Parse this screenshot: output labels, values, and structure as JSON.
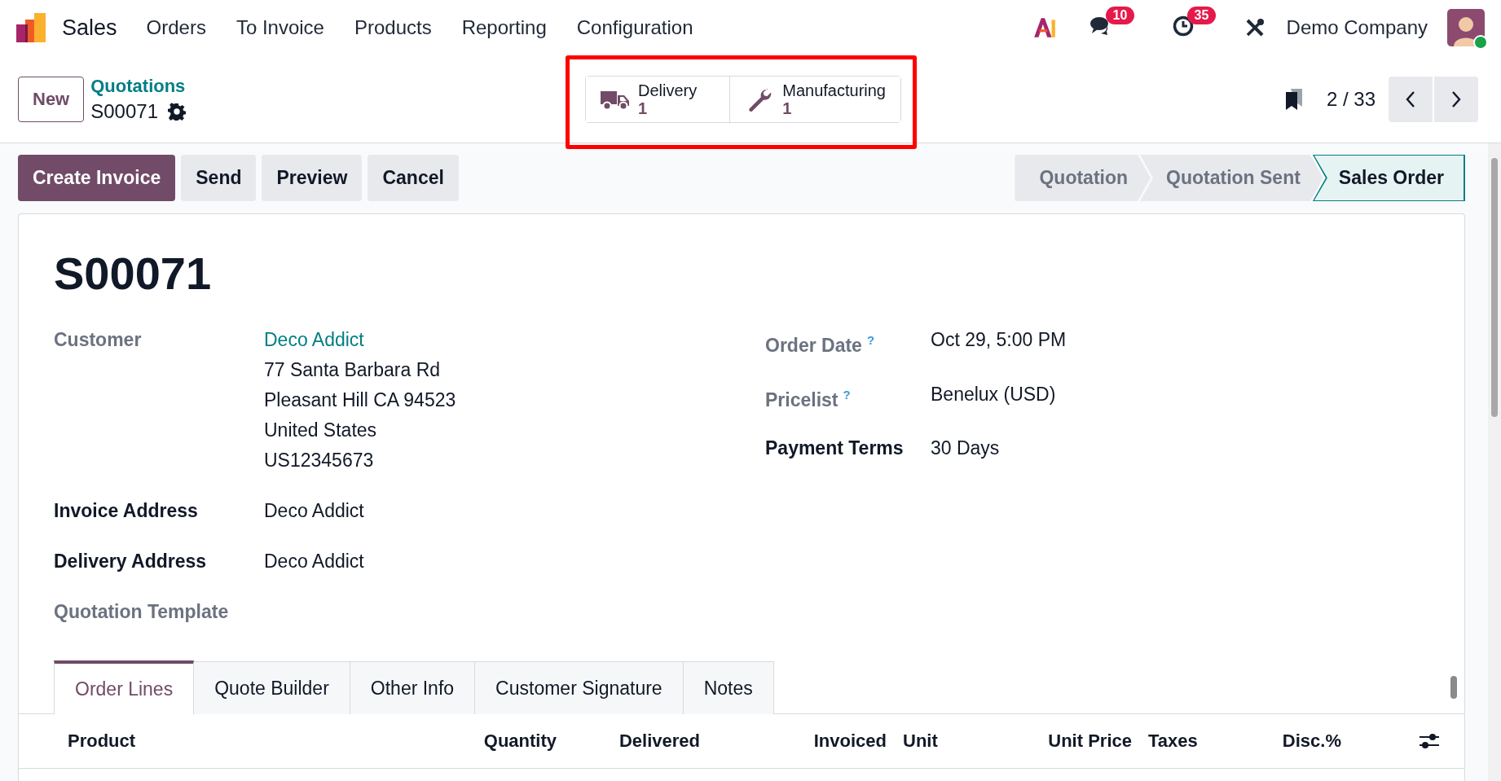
{
  "navbar": {
    "app_name": "Sales",
    "menu": [
      "Orders",
      "To Invoice",
      "Products",
      "Reporting",
      "Configuration"
    ],
    "message_count": "10",
    "activity_count": "35",
    "company": "Demo Company"
  },
  "control_panel": {
    "new_button": "New",
    "breadcrumb": "Quotations",
    "record": "S00071",
    "pager": "2 / 33",
    "smart_buttons": [
      {
        "kind": "truck",
        "label": "Delivery",
        "count": "1"
      },
      {
        "kind": "wrench",
        "label": "Manufacturing",
        "count": "1"
      }
    ]
  },
  "actions": [
    {
      "label": "Create Invoice",
      "primary": true
    },
    {
      "label": "Send",
      "primary": false
    },
    {
      "label": "Preview",
      "primary": false
    },
    {
      "label": "Cancel",
      "primary": false
    }
  ],
  "status_bar": [
    {
      "label": "Quotation",
      "selected": false
    },
    {
      "label": "Quotation Sent",
      "selected": false
    },
    {
      "label": "Sales Order",
      "selected": true
    }
  ],
  "form": {
    "title": "S00071",
    "left_fields": [
      {
        "label": "Customer",
        "required": false,
        "link": "Deco Addict",
        "values": [
          "77 Santa Barbara Rd",
          "Pleasant Hill CA 94523",
          "United States",
          "US12345673"
        ]
      },
      {
        "label": "Invoice Address",
        "required": true,
        "values": [
          "Deco Addict"
        ]
      },
      {
        "label": "Delivery Address",
        "required": true,
        "values": [
          "Deco Addict"
        ]
      },
      {
        "label": "Quotation Template",
        "required": false
      }
    ],
    "right_fields": [
      {
        "label": "Order Date",
        "required": false,
        "help_mark": "?",
        "values": [
          "Oct 29, 5:00 PM"
        ]
      },
      {
        "label": "Pricelist",
        "required": false,
        "help_mark": "?",
        "values": [
          "Benelux (USD)"
        ]
      },
      {
        "label": "Payment Terms",
        "required": true,
        "values": [
          "30 Days"
        ]
      }
    ]
  },
  "tabs": [
    {
      "label": "Order Lines",
      "selected": true
    },
    {
      "label": "Quote Builder",
      "selected": false
    },
    {
      "label": "Other Info",
      "selected": false
    },
    {
      "label": "Customer Signature",
      "selected": false
    },
    {
      "label": "Notes",
      "selected": false
    }
  ],
  "table": {
    "columns": [
      {
        "label": "Product",
        "kind": "text"
      },
      {
        "label": "Quantity",
        "kind": "number"
      },
      {
        "label": "Delivered",
        "kind": "number"
      },
      {
        "label": "Invoiced",
        "kind": "number"
      },
      {
        "label": "Unit",
        "kind": "text"
      },
      {
        "label": "Unit Price",
        "kind": "number"
      },
      {
        "label": "Taxes",
        "kind": "text"
      },
      {
        "label": "Disc.%",
        "kind": "number"
      }
    ]
  }
}
